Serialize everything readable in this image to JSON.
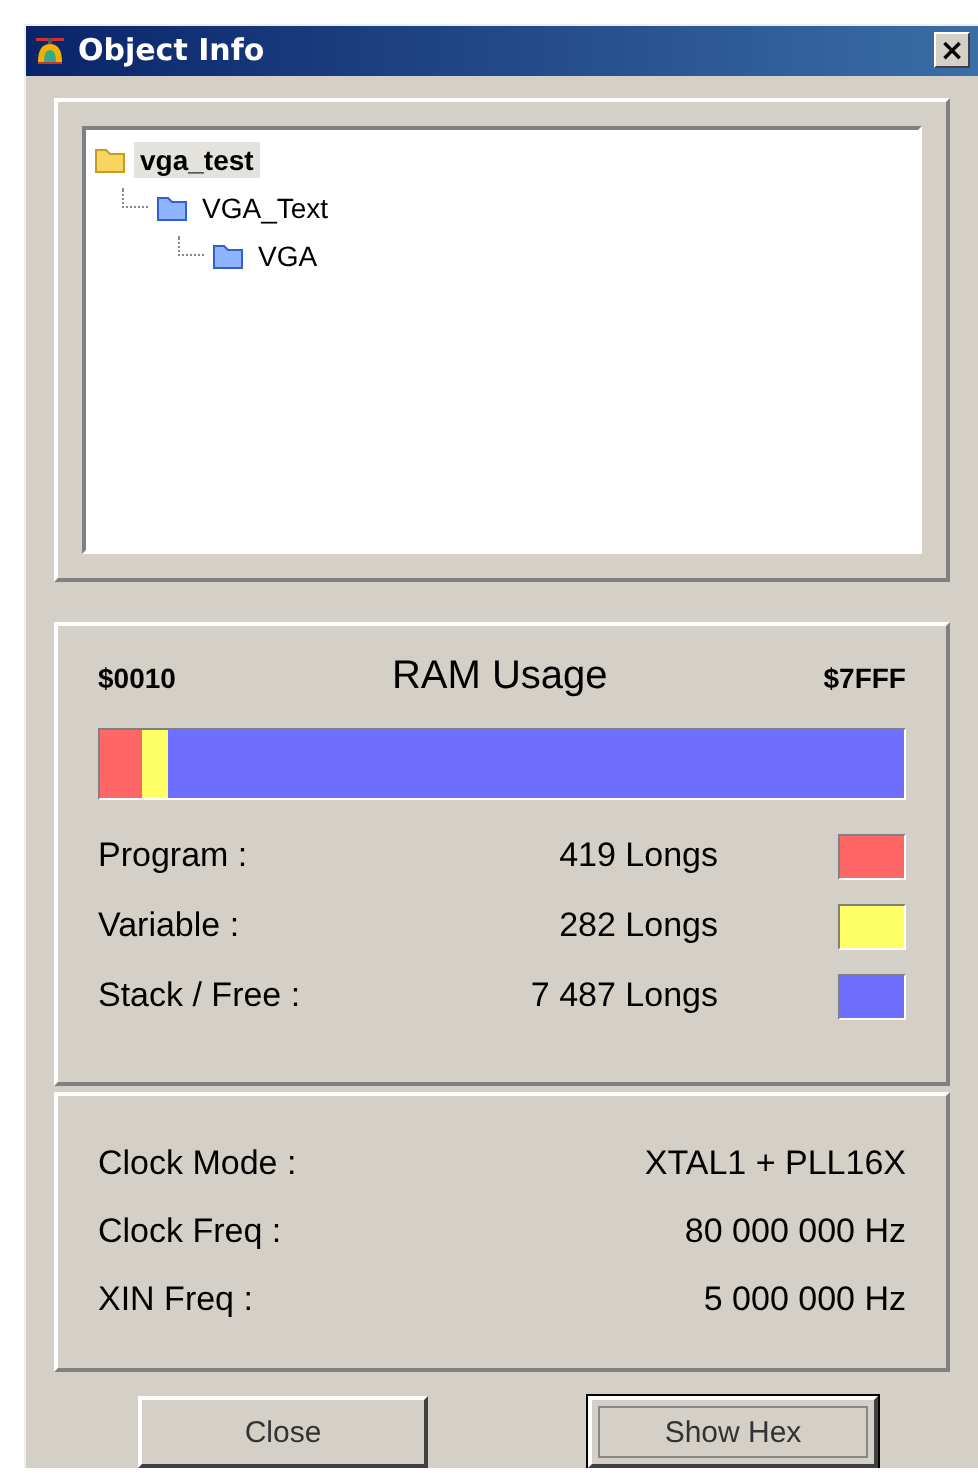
{
  "window": {
    "title": "Object Info",
    "close": "×"
  },
  "tree": [
    {
      "label": "vga_test",
      "kind": "top",
      "selected": true,
      "children": [
        {
          "label": "VGA_Text",
          "kind": "child",
          "selected": false,
          "children": [
            {
              "label": "VGA",
              "kind": "child",
              "selected": false
            }
          ]
        }
      ]
    }
  ],
  "ram": {
    "start": "$0010",
    "title": "RAM Usage",
    "end": "$7FFF",
    "segments": [
      {
        "label": "Program :",
        "value": "419 Longs",
        "color": "#ff6666",
        "level": 0.051
      },
      {
        "label": "Variable :",
        "value": "282 Longs",
        "color": "#ffff66",
        "level": 0.034
      },
      {
        "label": "Stack / Free :",
        "value": "7 487 Longs",
        "color": "#6f6fff",
        "level": 0.915
      }
    ]
  },
  "clock": [
    {
      "label": "Clock Mode :",
      "value": "XTAL1 + PLL16X"
    },
    {
      "label": "Clock Freq :",
      "value": "80 000 000 Hz"
    },
    {
      "label": "XIN Freq :",
      "value": "5 000 000 Hz"
    }
  ],
  "buttons": [
    {
      "label": "Close",
      "default": false
    },
    {
      "label": "Show Hex",
      "default": true
    }
  ]
}
